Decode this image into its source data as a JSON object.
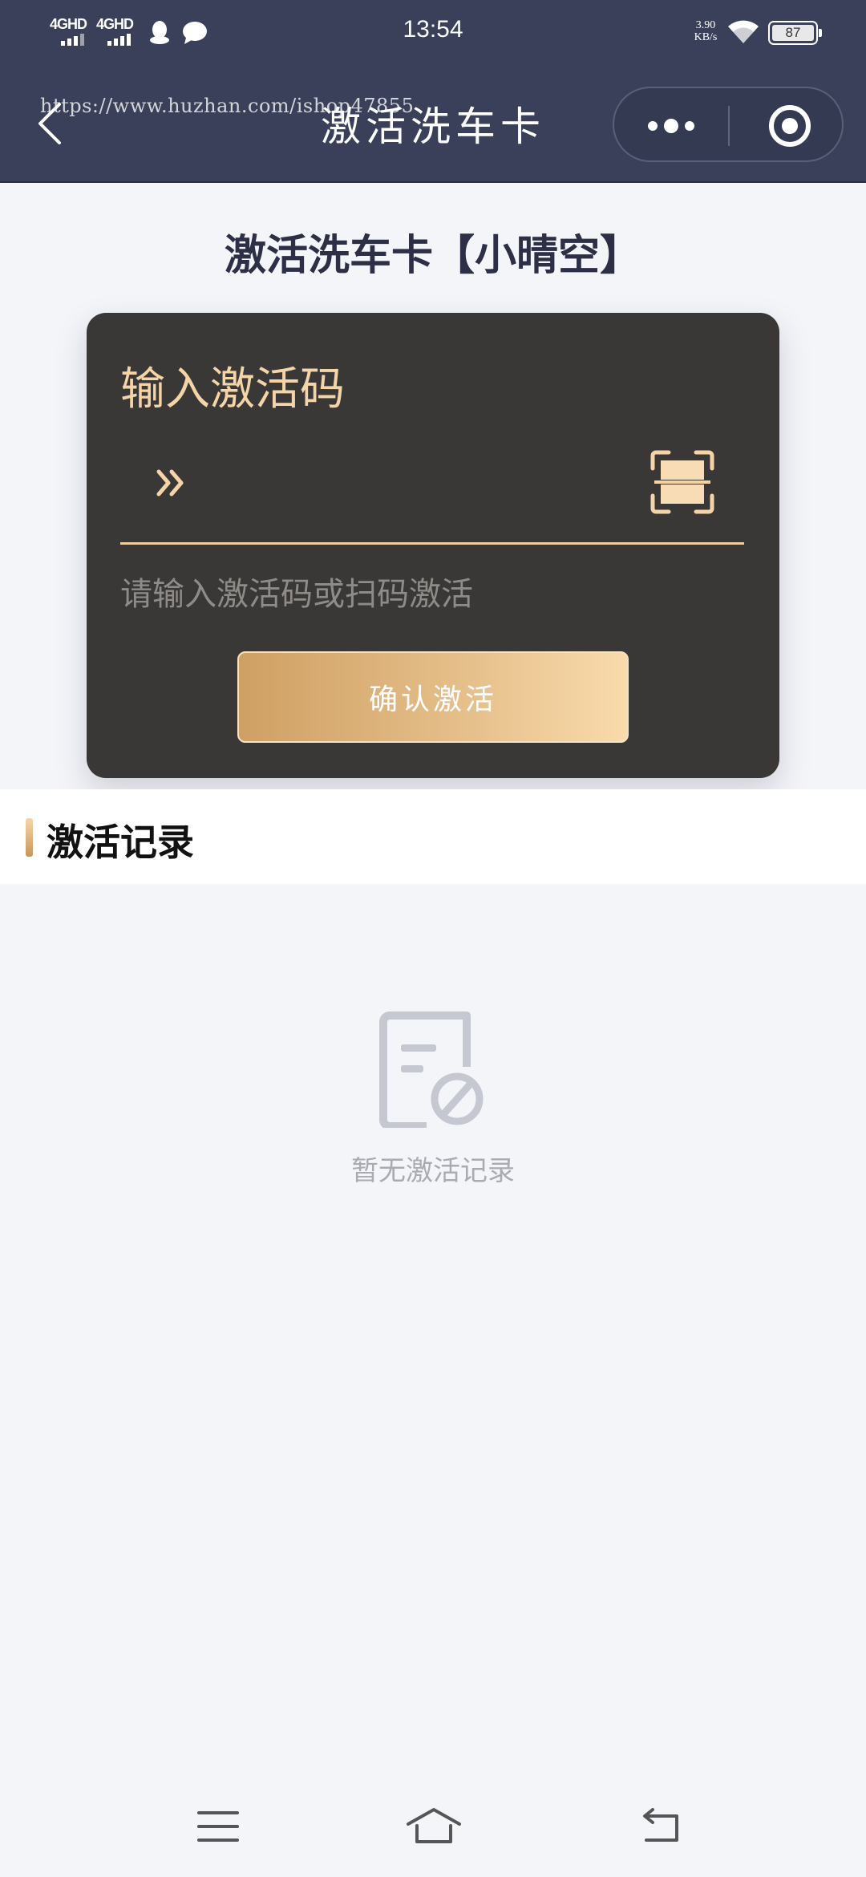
{
  "status_bar": {
    "time": "13:54",
    "sim1_label": "4GHD",
    "sim2_label": "4GHD",
    "network_speed_value": "3.90",
    "network_speed_unit": "KB/s",
    "battery_level": "87",
    "icons": [
      "qq-icon",
      "chat-icon",
      "wifi-icon",
      "battery-icon"
    ]
  },
  "nav": {
    "title": "激活洗车卡",
    "watermark": "https://www.huzhan.com/ishop47855",
    "icons": [
      "back-icon",
      "more-icon",
      "target-icon"
    ]
  },
  "page": {
    "title": "激活洗车卡【小晴空】"
  },
  "activation_card": {
    "label": "输入激活码",
    "input_value": "",
    "hint": "请输入激活码或扫码激活",
    "confirm_label": "确认激活",
    "icons": [
      "chevrons-right-icon",
      "scan-icon"
    ],
    "colors": {
      "card_bg": "#3a3836",
      "accent": "#f5d5a8",
      "button_start": "#cfa063",
      "button_end": "#f9dbac"
    }
  },
  "records": {
    "title": "激活记录",
    "empty_text": "暂无激活记录",
    "icons": [
      "empty-record-icon"
    ]
  },
  "system_nav": {
    "icons": [
      "menu-icon",
      "home-icon",
      "return-icon"
    ]
  }
}
